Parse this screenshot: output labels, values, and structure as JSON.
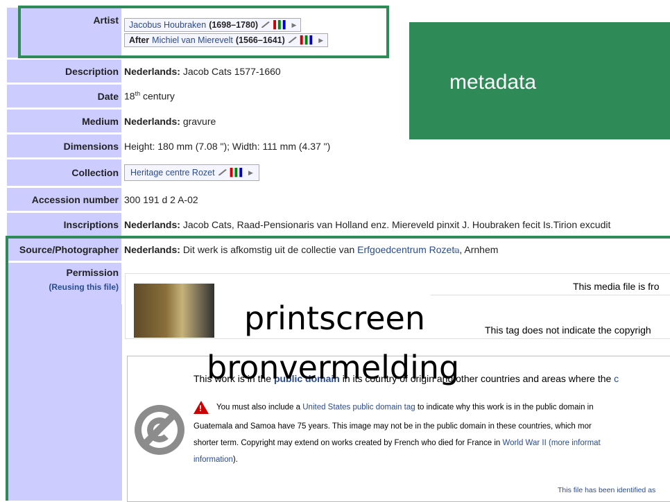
{
  "rows": {
    "artist_label": "Artist",
    "artist1": {
      "name": "Jacobus Houbraken",
      "dates": "(1698–1780)"
    },
    "artist2": {
      "prefix": "After",
      "name": "Michiel van Mierevelt",
      "dates": "(1566–1641)"
    },
    "description_label": "Description",
    "description_lang": "Nederlands:",
    "description_text": "Jacob Cats 1577-1660",
    "date_label": "Date",
    "date_value_pre": "18",
    "date_value_sup": "th",
    "date_value_post": "century",
    "medium_label": "Medium",
    "medium_lang": "Nederlands:",
    "medium_text": "gravure",
    "dimensions_label": "Dimensions",
    "dimensions_text": "Height: 180 mm (7.08 \"); Width: 111 mm (4.37 \")",
    "collection_label": "Collection",
    "collection_name": "Heritage centre Rozet",
    "accession_label": "Accession number",
    "accession_text": "300 191 d 2 A-02",
    "inscriptions_label": "Inscriptions",
    "inscriptions_lang": "Nederlands:",
    "inscriptions_text": "Jacob Cats, Raad-Pensionaris van Holland enz. Miereveld pinxit J. Houbraken fecit Is.Tirion excudit",
    "source_label": "Source/Photographer",
    "source_lang": "Nederlands:",
    "source_text": "Dit werk is afkomstig uit de collectie van",
    "source_link": "Erfgoedcentrum Rozet",
    "source_post": ", Arnhem",
    "permission_label": "Permission",
    "reusing_link": "(Reusing this file)"
  },
  "media_box": {
    "top_text": "This media file is fro",
    "mid_text": "This tag does not indicate the copyrigh"
  },
  "pd_box": {
    "line1_pre": "This work is in the",
    "line1_link": "public domain",
    "line1_post": "in its country of origin and other countries and areas where the",
    "line1_tail": "c",
    "warn_pre": "You must also include a",
    "warn_link": "United States public domain tag",
    "warn_post": "to indicate why this work is in the public domain in",
    "line3": "Guatemala and Samoa have 75 years. This image may not be in the public domain in these countries, which mor",
    "line4_pre": "shorter term. Copyright may extend on works created by French who died for France in",
    "line4_link": "World War II",
    "line4_link2": "(more informat",
    "line5_link": "information",
    "line5_post": ").",
    "footer": "This file has been identified as"
  },
  "overlays": {
    "metadata_label": "metadata",
    "printscreen": "printscreen",
    "bronvermelding": "bronvermelding"
  },
  "colors": {
    "label_bg": "#ccccff",
    "green": "#2e8b57",
    "link": "#2a4b8d"
  }
}
